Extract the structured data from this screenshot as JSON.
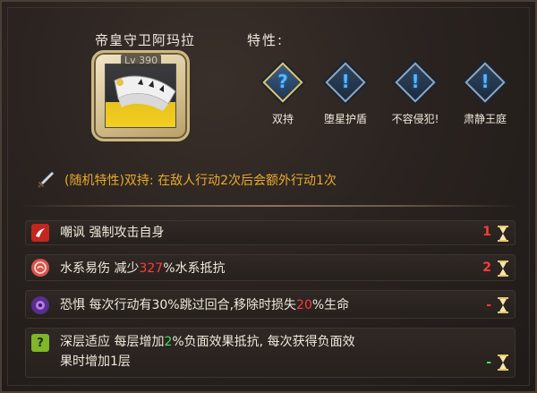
{
  "hero": {
    "name": "帝皇守卫阿玛拉",
    "level": "Lv 390"
  },
  "traits": {
    "label": "特性:",
    "items": [
      {
        "name": "双持",
        "icon": "question-icon",
        "glyph": "?",
        "selected": true
      },
      {
        "name": "堕星护盾",
        "icon": "exclamation-icon",
        "glyph": "!"
      },
      {
        "name": "不容侵犯!",
        "icon": "exclamation-icon",
        "glyph": "!"
      },
      {
        "name": "肃静王庭",
        "icon": "exclamation-icon",
        "glyph": "!"
      }
    ]
  },
  "random_trait": {
    "icon": "sword-icon",
    "text": "(随机特性)双持: 在敌人行动2次后会额外行动1次"
  },
  "effects": [
    {
      "icon": "taunt-icon",
      "parts": [
        "嘲讽 强制攻击自身"
      ],
      "turns": "1",
      "turns_color": "#ff3b3b"
    },
    {
      "icon": "water-vulnerable-icon",
      "parts": [
        "水系易伤 减少",
        "327",
        "%水系抵抗"
      ],
      "turns": "2",
      "turns_color": "#ff3b3b"
    },
    {
      "icon": "fear-icon",
      "parts": [
        "恐惧 每次行动有30%跳过回合,移除时损失",
        "20",
        "%生命"
      ],
      "turns": "-",
      "turns_color": "#ff3b3b"
    },
    {
      "icon": "deep-adapt-icon",
      "parts": [
        "深层适应 每层增加",
        "2",
        "%负面效果抵抗, 每次获得负面效",
        "果时增加1层"
      ],
      "turns": "-",
      "turns_color": "#40e25a"
    }
  ],
  "colors": {
    "accent_gold": "#e8ab2c",
    "debuff_red": "#ff3b3b",
    "buff_green": "#40e25a",
    "trait_blue": "#59b6ff"
  }
}
